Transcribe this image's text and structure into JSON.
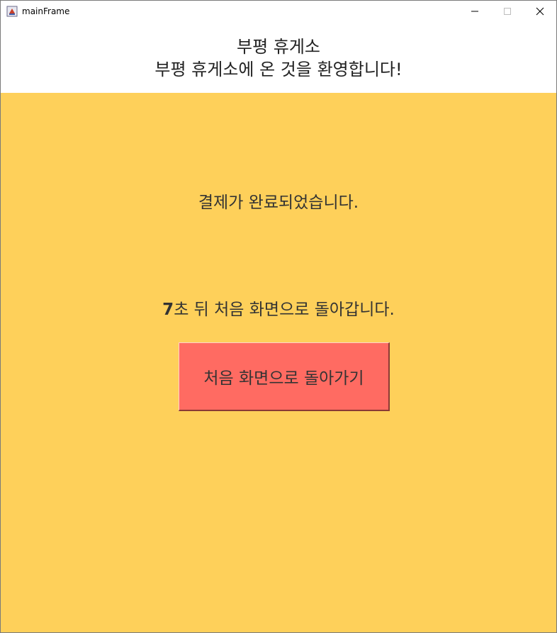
{
  "window": {
    "title": "mainFrame",
    "app_icon": "java-app-icon",
    "controls": [
      "minimize-icon",
      "maximize-icon",
      "close-icon"
    ]
  },
  "header": {
    "line1": "부평 휴게소",
    "line2": "부평 휴게소에 온 것을 환영합니다!"
  },
  "main": {
    "payment_message": "결제가 완료되었습니다.",
    "countdown_seconds": "7",
    "countdown_suffix": "초 뒤 처음 화면으로 돌아갑니다.",
    "home_button_label": "처음 화면으로 돌아가기"
  },
  "colors": {
    "background": "#fed05a",
    "button": "#ff6b62",
    "header_bg": "#ffffff"
  }
}
